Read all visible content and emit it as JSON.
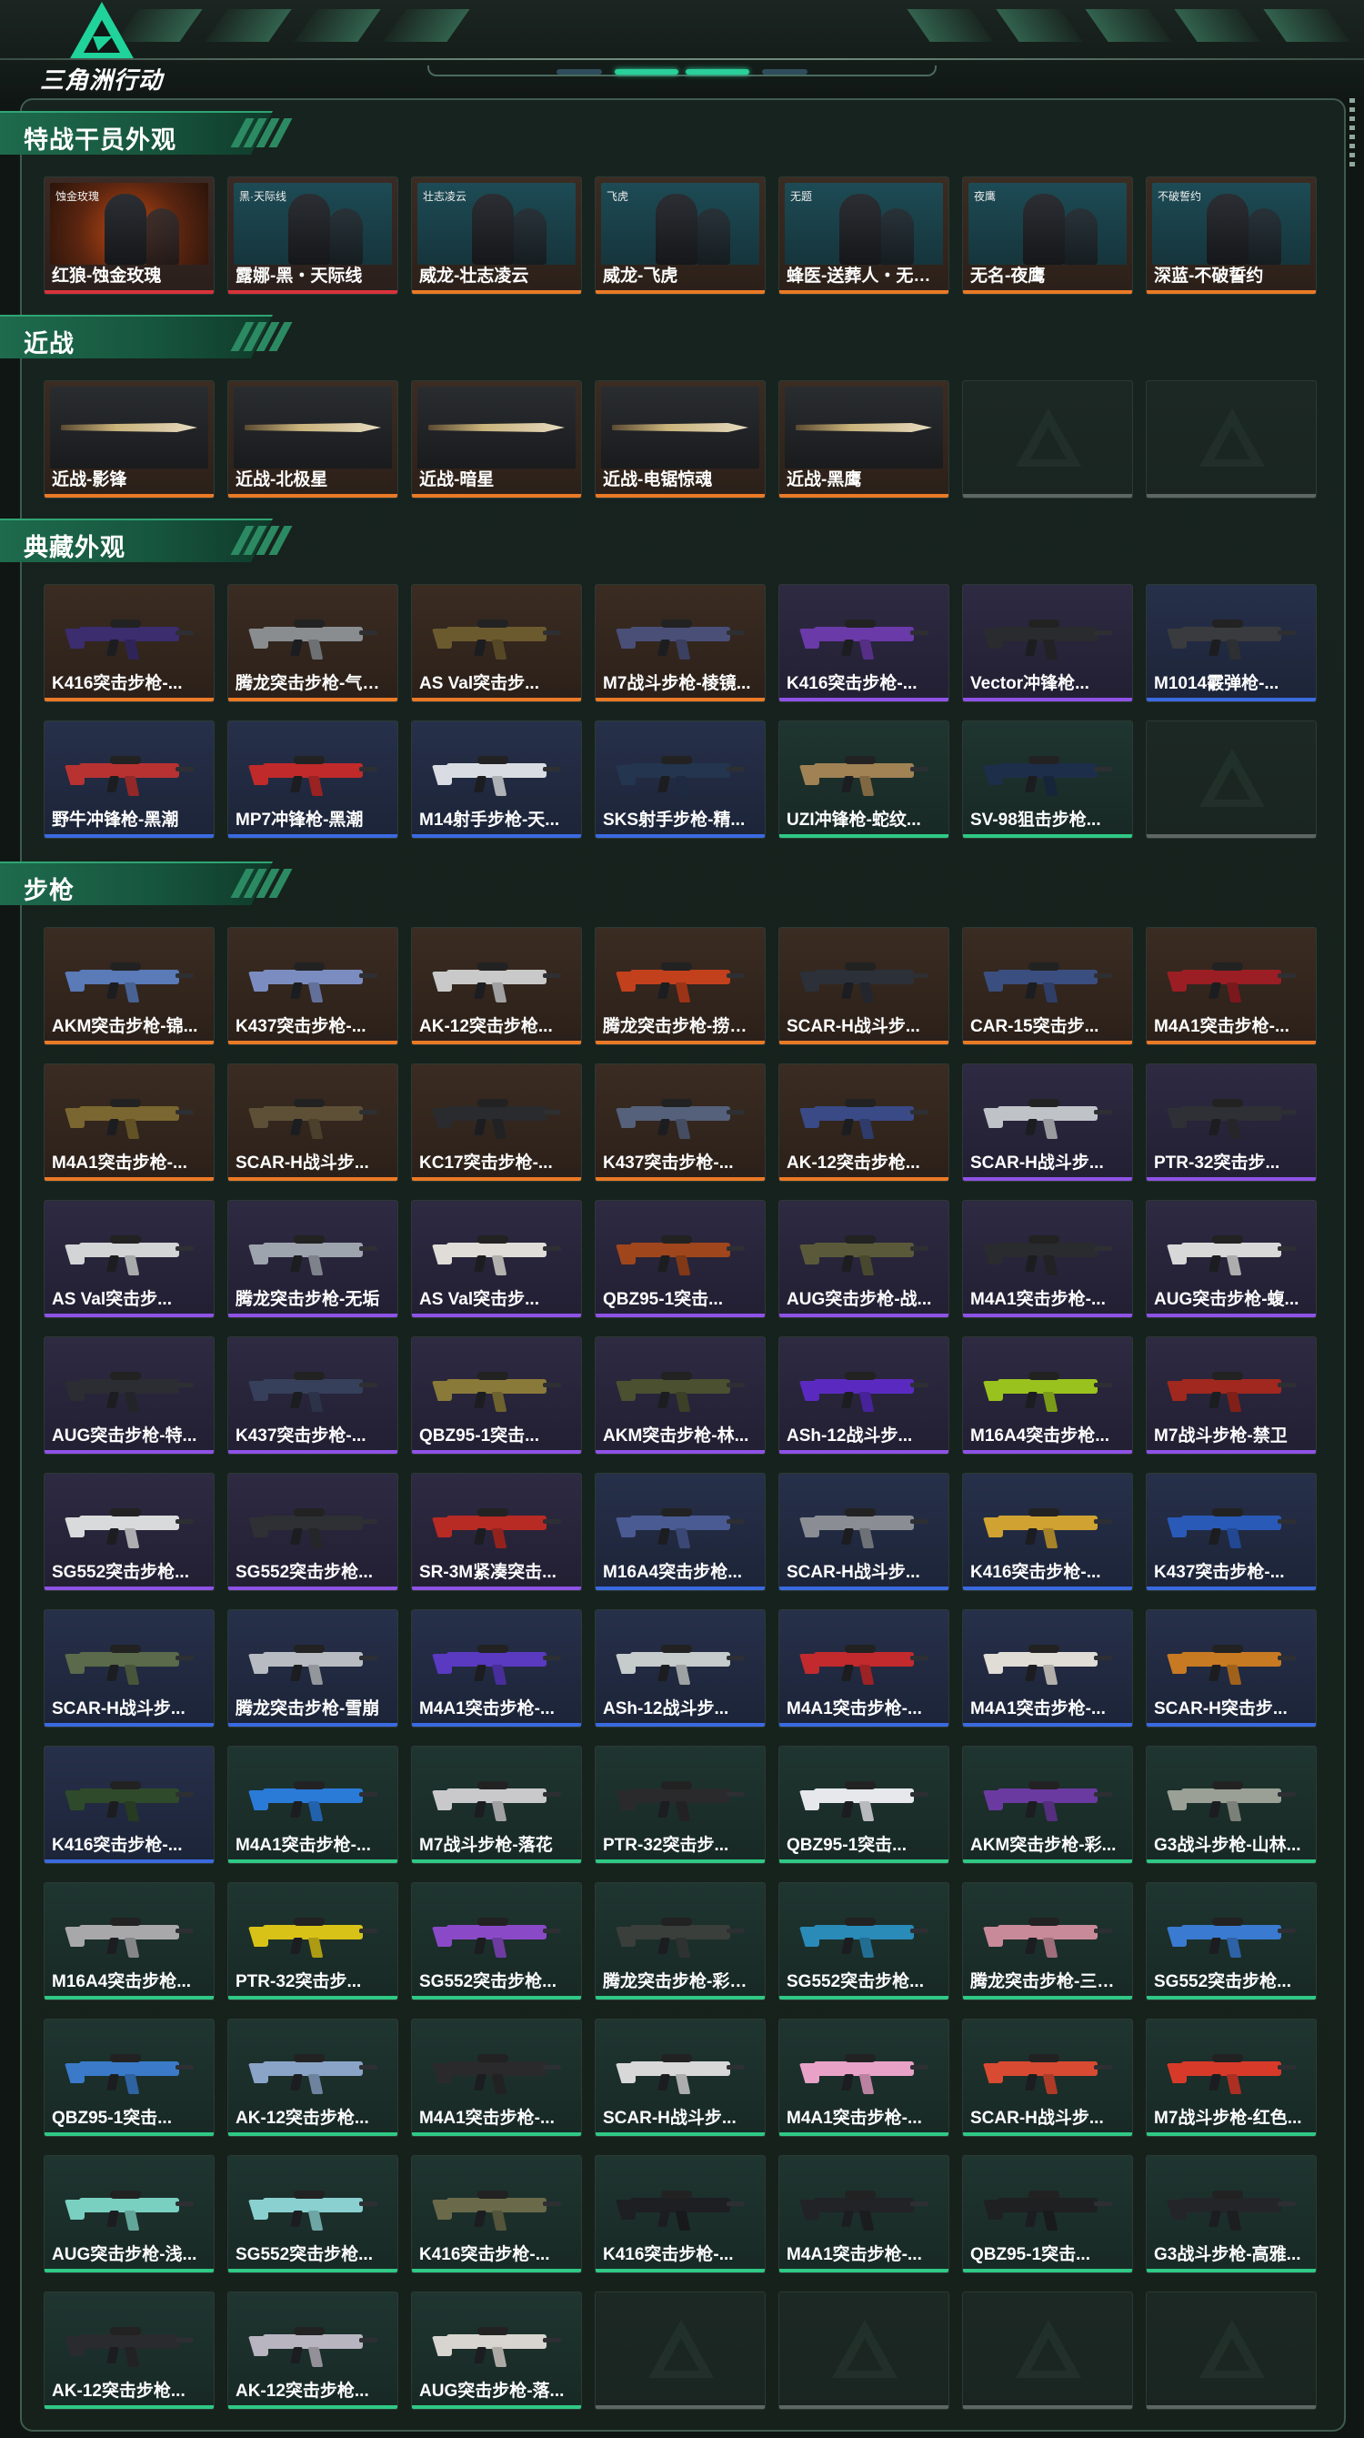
{
  "header": {
    "logo_text": "三角洲行动"
  },
  "colors": {
    "rarity_red": "#d8323a",
    "rarity_orange": "#ea7a26",
    "rarity_purple": "#8e52e6",
    "rarity_blue": "#3a6ae0",
    "rarity_green": "#2fc985",
    "accent": "#2ad09a"
  },
  "sections": [
    {
      "title": "特战干员外观",
      "kind": "operator",
      "items": [
        {
          "label": "红狼-蚀金玫瑰",
          "rarity": "red",
          "art_text": "蚀金玫瑰",
          "art": "fire"
        },
        {
          "label": "露娜-黑・天际线",
          "rarity": "red",
          "art_text": "黑·天际线",
          "art": ""
        },
        {
          "label": "威龙-壮志凌云",
          "rarity": "orange",
          "art_text": "壮志凌云",
          "art": ""
        },
        {
          "label": "威龙-飞虎",
          "rarity": "orange",
          "art_text": "飞虎",
          "art": ""
        },
        {
          "label": "蜂医-送葬人・无题...",
          "rarity": "orange",
          "art_text": "无题",
          "art": ""
        },
        {
          "label": "无名-夜鹰",
          "rarity": "orange",
          "art_text": "夜鹰",
          "art": ""
        },
        {
          "label": "深蓝-不破誓约",
          "rarity": "orange",
          "art_text": "不破誓约",
          "art": ""
        }
      ]
    },
    {
      "title": "近战",
      "kind": "melee",
      "items": [
        {
          "label": "近战-影锋",
          "rarity": "orange"
        },
        {
          "label": "近战-北极星",
          "rarity": "orange"
        },
        {
          "label": "近战-暗星",
          "rarity": "orange"
        },
        {
          "label": "近战-电锯惊魂",
          "rarity": "orange"
        },
        {
          "label": "近战-黑鹰",
          "rarity": "orange"
        },
        {
          "label": "",
          "rarity": "empty"
        },
        {
          "label": "",
          "rarity": "empty"
        }
      ]
    },
    {
      "title": "典藏外观",
      "kind": "gun",
      "items": [
        {
          "label": "K416突击步枪-...",
          "rarity": "orange",
          "color": "#3b2d6e"
        },
        {
          "label": "腾龙突击步枪-气象...",
          "rarity": "orange",
          "color": "#8a8d90"
        },
        {
          "label": "AS Val突击步...",
          "rarity": "orange",
          "color": "#6b5a2e"
        },
        {
          "label": "M7战斗步枪-棱镜...",
          "rarity": "orange",
          "color": "#4a4f78"
        },
        {
          "label": "K416突击步枪-...",
          "rarity": "purple",
          "color": "#6a3aa8"
        },
        {
          "label": "Vector冲锋枪...",
          "rarity": "purple",
          "color": "#2a2b2e"
        },
        {
          "label": "M1014霰弹枪-...",
          "rarity": "blue",
          "color": "#3a3b3e"
        },
        {
          "label": "野牛冲锋枪-黑潮",
          "rarity": "blue",
          "color": "#b83232"
        },
        {
          "label": "MP7冲锋枪-黑潮",
          "rarity": "blue",
          "color": "#c02a2a"
        },
        {
          "label": "M14射手步枪-天...",
          "rarity": "blue",
          "color": "#d9dde3"
        },
        {
          "label": "SKS射手步枪-精...",
          "rarity": "blue",
          "color": "#243550"
        },
        {
          "label": "UZI冲锋枪-蛇纹...",
          "rarity": "green",
          "color": "#a08254"
        },
        {
          "label": "SV-98狙击步枪...",
          "rarity": "green",
          "color": "#1d2e4a"
        },
        {
          "label": "",
          "rarity": "empty"
        }
      ]
    },
    {
      "title": "步枪",
      "kind": "gun",
      "items": [
        {
          "label": "AKM突击步枪-锦...",
          "rarity": "orange",
          "color": "#5a7ab8"
        },
        {
          "label": "K437突击步枪-...",
          "rarity": "orange",
          "color": "#7b8cc0"
        },
        {
          "label": "AK-12突击步枪...",
          "rarity": "orange",
          "color": "#c9c9c9"
        },
        {
          "label": "腾龙突击步枪-捞点...",
          "rarity": "orange",
          "color": "#c2401c"
        },
        {
          "label": "SCAR-H战斗步...",
          "rarity": "orange",
          "color": "#2c3038"
        },
        {
          "label": "CAR-15突击步...",
          "rarity": "orange",
          "color": "#3a4e80"
        },
        {
          "label": "M4A1突击步枪-...",
          "rarity": "orange",
          "color": "#9a1e24"
        },
        {
          "label": "M4A1突击步枪-...",
          "rarity": "orange",
          "color": "#7a6630"
        },
        {
          "label": "SCAR-H战斗步...",
          "rarity": "orange",
          "color": "#5e5036"
        },
        {
          "label": "KC17突击步枪-...",
          "rarity": "orange",
          "color": "#2a2b2e"
        },
        {
          "label": "K437突击步枪-...",
          "rarity": "orange",
          "color": "#55607a"
        },
        {
          "label": "AK-12突击步枪...",
          "rarity": "orange",
          "color": "#3a4a86"
        },
        {
          "label": "SCAR-H战斗步...",
          "rarity": "purple",
          "color": "#bfc2c6"
        },
        {
          "label": "PTR-32突击步...",
          "rarity": "purple",
          "color": "#2f3035"
        },
        {
          "label": "AS Val突击步...",
          "rarity": "purple",
          "color": "#d2d4d6"
        },
        {
          "label": "腾龙突击步枪-无垢",
          "rarity": "purple",
          "color": "#9ea4ae"
        },
        {
          "label": "AS Val突击步...",
          "rarity": "purple",
          "color": "#e0ddd8"
        },
        {
          "label": "QBZ95-1突击...",
          "rarity": "purple",
          "color": "#a0461c"
        },
        {
          "label": "AUG突击步枪-战...",
          "rarity": "purple",
          "color": "#5a5a3a"
        },
        {
          "label": "M4A1突击步枪-...",
          "rarity": "purple",
          "color": "#2a2b2e"
        },
        {
          "label": "AUG突击步枪-蝮...",
          "rarity": "purple",
          "color": "#d8d8d8"
        },
        {
          "label": "AUG突击步枪-特...",
          "rarity": "purple",
          "color": "#2b2d33"
        },
        {
          "label": "K437突击步枪-...",
          "rarity": "purple",
          "color": "#37405a"
        },
        {
          "label": "QBZ95-1突击...",
          "rarity": "purple",
          "color": "#8a7a3a"
        },
        {
          "label": "AKM突击步枪-林...",
          "rarity": "purple",
          "color": "#4a5030"
        },
        {
          "label": "ASh-12战斗步...",
          "rarity": "purple",
          "color": "#5a2ac0"
        },
        {
          "label": "M16A4突击步枪...",
          "rarity": "purple",
          "color": "#9ac21e"
        },
        {
          "label": "M7战斗步枪-禁卫",
          "rarity": "purple",
          "color": "#a0281e"
        },
        {
          "label": "SG552突击步枪...",
          "rarity": "purple",
          "color": "#d9dadc"
        },
        {
          "label": "SG552突击步枪...",
          "rarity": "purple",
          "color": "#2e3034"
        },
        {
          "label": "SR-3M紧凑突击...",
          "rarity": "purple",
          "color": "#b82a24"
        },
        {
          "label": "M16A4突击步枪...",
          "rarity": "blue",
          "color": "#4a5a92"
        },
        {
          "label": "SCAR-H战斗步...",
          "rarity": "blue",
          "color": "#8a8d94"
        },
        {
          "label": "K416突击步枪-...",
          "rarity": "blue",
          "color": "#d0a232"
        },
        {
          "label": "K437突击步枪-...",
          "rarity": "blue",
          "color": "#2a5ab8"
        },
        {
          "label": "SCAR-H战斗步...",
          "rarity": "blue",
          "color": "#5a6a4a"
        },
        {
          "label": "腾龙突击步枪-雪崩",
          "rarity": "blue",
          "color": "#b8bcc2"
        },
        {
          "label": "M4A1突击步枪-...",
          "rarity": "blue",
          "color": "#5a3ac0"
        },
        {
          "label": "ASh-12战斗步...",
          "rarity": "blue",
          "color": "#c6cbcc"
        },
        {
          "label": "M4A1突击步枪-...",
          "rarity": "blue",
          "color": "#c22a2e"
        },
        {
          "label": "M4A1突击步枪-...",
          "rarity": "blue",
          "color": "#e0dcd6"
        },
        {
          "label": "SCAR-H突击步...",
          "rarity": "blue",
          "color": "#c87a22"
        },
        {
          "label": "K416突击步枪-...",
          "rarity": "blue",
          "color": "#2f4a2a"
        },
        {
          "label": "M4A1突击步枪-...",
          "rarity": "green",
          "color": "#2a7ad8"
        },
        {
          "label": "M7战斗步枪-落花",
          "rarity": "green",
          "color": "#c9c9cc"
        },
        {
          "label": "PTR-32突击步...",
          "rarity": "green",
          "color": "#2a2a2c"
        },
        {
          "label": "QBZ95-1突击...",
          "rarity": "green",
          "color": "#e6e8ec"
        },
        {
          "label": "AKM突击步枪-彩...",
          "rarity": "green",
          "color": "#6a3aa0"
        },
        {
          "label": "G3战斗步枪-山林...",
          "rarity": "green",
          "color": "#9aa096"
        },
        {
          "label": "M16A4突击步枪...",
          "rarity": "green",
          "color": "#a8a8aa"
        },
        {
          "label": "PTR-32突击步...",
          "rarity": "green",
          "color": "#d8c218"
        },
        {
          "label": "SG552突击步枪...",
          "rarity": "green",
          "color": "#8a4ac8"
        },
        {
          "label": "腾龙突击步枪-彩墨...",
          "rarity": "green",
          "color": "#3a3f3c"
        },
        {
          "label": "SG552突击步枪...",
          "rarity": "green",
          "color": "#2a8ab8"
        },
        {
          "label": "腾龙突击步枪-三角...",
          "rarity": "green",
          "color": "#c88a98"
        },
        {
          "label": "SG552突击步枪...",
          "rarity": "green",
          "color": "#3a7ad0"
        },
        {
          "label": "QBZ95-1突击...",
          "rarity": "green",
          "color": "#3a7ac8"
        },
        {
          "label": "AK-12突击步枪...",
          "rarity": "green",
          "color": "#8aa4c8"
        },
        {
          "label": "M4A1突击步枪-...",
          "rarity": "green",
          "color": "#2a2a2c"
        },
        {
          "label": "SCAR-H战斗步...",
          "rarity": "green",
          "color": "#d8d8d8"
        },
        {
          "label": "M4A1突击步枪-...",
          "rarity": "green",
          "color": "#e8a2c8"
        },
        {
          "label": "SCAR-H战斗步...",
          "rarity": "green",
          "color": "#d84a32"
        },
        {
          "label": "M7战斗步枪-红色...",
          "rarity": "green",
          "color": "#d83a2a"
        },
        {
          "label": "AUG突击步枪-浅...",
          "rarity": "green",
          "color": "#7ad0c0"
        },
        {
          "label": "SG552突击步枪...",
          "rarity": "green",
          "color": "#8ad0d0"
        },
        {
          "label": "K416突击步枪-...",
          "rarity": "green",
          "color": "#6a6a4a"
        },
        {
          "label": "K416突击步枪-...",
          "rarity": "green",
          "color": "#1e1f22"
        },
        {
          "label": "M4A1突击步枪-...",
          "rarity": "green",
          "color": "#222326"
        },
        {
          "label": "QBZ95-1突击...",
          "rarity": "green",
          "color": "#1f2022"
        },
        {
          "label": "G3战斗步枪-高雅...",
          "rarity": "green",
          "color": "#242528"
        },
        {
          "label": "AK-12突击步枪...",
          "rarity": "green",
          "color": "#2a2b2e"
        },
        {
          "label": "AK-12突击步枪...",
          "rarity": "green",
          "color": "#b8b4c0"
        },
        {
          "label": "AUG突击步枪-落...",
          "rarity": "green",
          "color": "#d8d4d0"
        },
        {
          "label": "",
          "rarity": "empty"
        },
        {
          "label": "",
          "rarity": "empty"
        },
        {
          "label": "",
          "rarity": "empty"
        },
        {
          "label": "",
          "rarity": "empty"
        }
      ]
    }
  ]
}
